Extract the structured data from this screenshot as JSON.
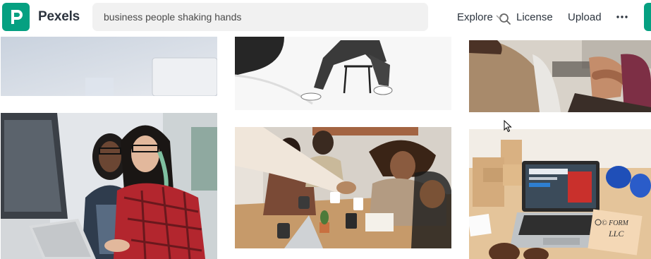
{
  "brand": {
    "name": "Pexels",
    "logo_letter": "P",
    "accent_color": "#05a081"
  },
  "search": {
    "value": "business people shaking hands",
    "icon": "search-icon"
  },
  "nav": {
    "explore": "Explore",
    "license": "License",
    "upload": "Upload",
    "more_icon": "more-dots-icon",
    "dropdown_icon": "chevron-down-icon"
  },
  "photos": {
    "laptop_note_text_1": "© FORM",
    "laptop_note_text_2": "LLC"
  }
}
